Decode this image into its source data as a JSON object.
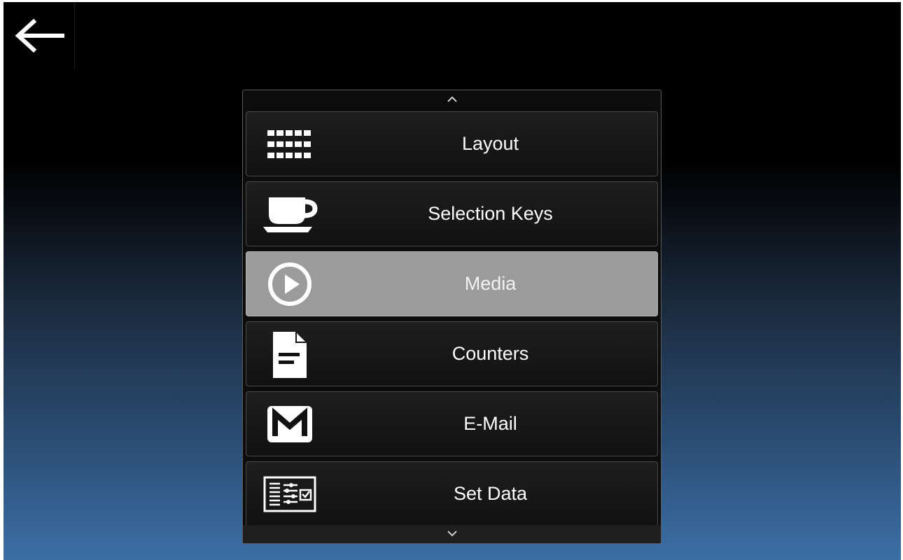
{
  "header": {
    "back_icon": "arrow-left-icon"
  },
  "menu": {
    "scroll_up_icon": "chevron-up-icon",
    "scroll_down_icon": "chevron-down-icon",
    "selected_index": 2,
    "items": [
      {
        "label": "Layout",
        "icon": "grid-icon"
      },
      {
        "label": "Selection Keys",
        "icon": "coffee-cup-icon"
      },
      {
        "label": "Media",
        "icon": "play-circle-icon"
      },
      {
        "label": "Counters",
        "icon": "document-icon"
      },
      {
        "label": "E-Mail",
        "icon": "mail-icon"
      },
      {
        "label": "Set Data",
        "icon": "settings-list-icon"
      }
    ]
  },
  "colors": {
    "item_background": "#151515",
    "selected_background": "#9b9b9b",
    "screen_gradient_bottom": "#3c6ea5",
    "text": "#ffffff"
  }
}
